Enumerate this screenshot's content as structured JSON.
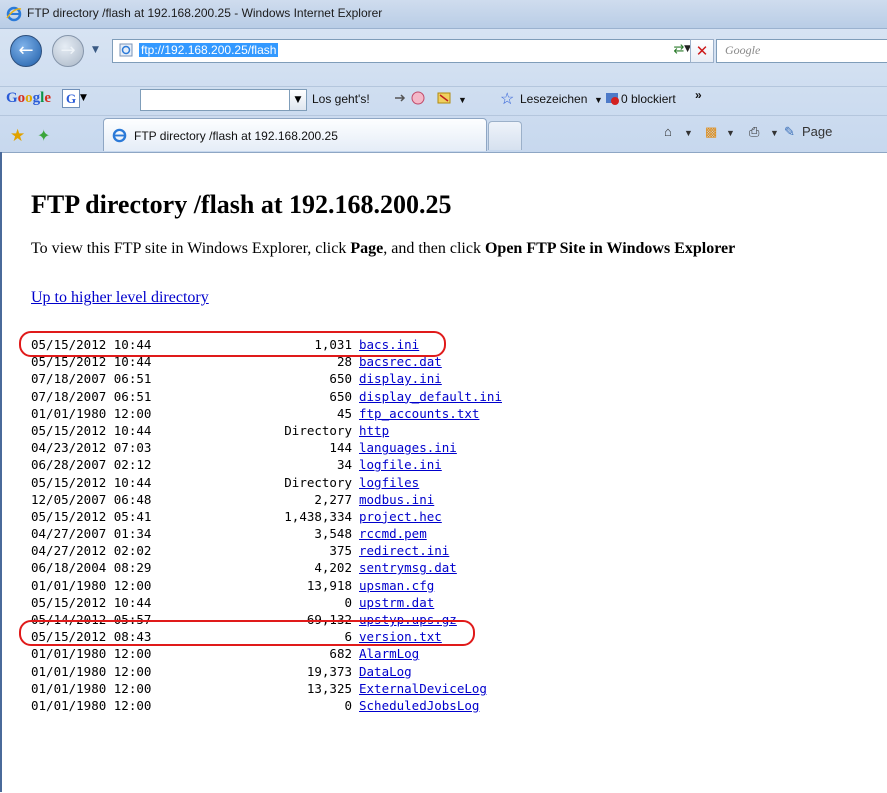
{
  "window": {
    "title": "FTP directory /flash at 192.168.200.25 - Windows Internet Explorer"
  },
  "address_bar": {
    "url": "ftp://192.168.200.25/flash"
  },
  "search_box": {
    "placeholder": "Google"
  },
  "google_toolbar": {
    "logo": "Google",
    "g_button": "G",
    "go_label": "Los geht's!",
    "bookmarks_label": "Lesezeichen",
    "blocked_label": "0 blockiert",
    "more": "»"
  },
  "tab": {
    "title": "FTP directory /flash at 192.168.200.25"
  },
  "command_bar": {
    "page_label": "Page"
  },
  "page": {
    "heading": "FTP directory /flash at 192.168.200.25",
    "info_prefix": "To view this FTP site in Windows Explorer, click ",
    "info_page": "Page",
    "info_mid": ", and then click ",
    "info_open": "Open FTP Site in Windows Explorer",
    "up_link": "Up to higher level directory"
  },
  "listing": [
    {
      "date": "05/15/2012 10:44",
      "size": "1,031",
      "name": "bacs.ini",
      "highlighted": true
    },
    {
      "date": "05/15/2012 10:44",
      "size": "28",
      "name": "bacsrec.dat"
    },
    {
      "date": "07/18/2007 06:51",
      "size": "650",
      "name": "display.ini"
    },
    {
      "date": "07/18/2007 06:51",
      "size": "650",
      "name": "display_default.ini"
    },
    {
      "date": "01/01/1980 12:00",
      "size": "45",
      "name": "ftp_accounts.txt"
    },
    {
      "date": "05/15/2012 10:44",
      "size": "Directory",
      "name": "http"
    },
    {
      "date": "04/23/2012 07:03",
      "size": "144",
      "name": "languages.ini"
    },
    {
      "date": "06/28/2007 02:12",
      "size": "34",
      "name": "logfile.ini"
    },
    {
      "date": "05/15/2012 10:44",
      "size": "Directory",
      "name": "logfiles"
    },
    {
      "date": "12/05/2007 06:48",
      "size": "2,277",
      "name": "modbus.ini"
    },
    {
      "date": "05/15/2012 05:41",
      "size": "1,438,334",
      "name": "project.hec"
    },
    {
      "date": "04/27/2007 01:34",
      "size": "3,548",
      "name": "rccmd.pem"
    },
    {
      "date": "04/27/2012 02:02",
      "size": "375",
      "name": "redirect.ini"
    },
    {
      "date": "06/18/2004 08:29",
      "size": "4,202",
      "name": "sentrymsg.dat"
    },
    {
      "date": "01/01/1980 12:00",
      "size": "13,918",
      "name": "upsman.cfg",
      "highlighted": true
    },
    {
      "date": "05/15/2012 10:44",
      "size": "0",
      "name": "upstrm.dat"
    },
    {
      "date": "05/14/2012 05:57",
      "size": "69,132",
      "name": "upstyp.ups.gz"
    },
    {
      "date": "05/15/2012 08:43",
      "size": "6",
      "name": "version.txt"
    },
    {
      "date": "01/01/1980 12:00",
      "size": "682",
      "name": "AlarmLog"
    },
    {
      "date": "01/01/1980 12:00",
      "size": "19,373",
      "name": "DataLog"
    },
    {
      "date": "01/01/1980 12:00",
      "size": "13,325",
      "name": "ExternalDeviceLog"
    },
    {
      "date": "01/01/1980 12:00",
      "size": "0",
      "name": "ScheduledJobsLog"
    }
  ],
  "colors": {
    "link": "#0000cc",
    "highlight": "#e01a1a",
    "selection": "#3399ff"
  }
}
